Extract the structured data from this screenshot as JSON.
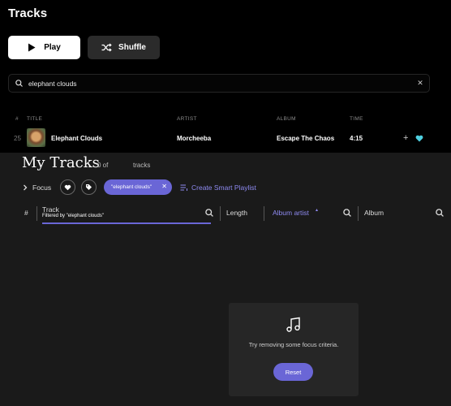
{
  "top": {
    "title": "Tracks",
    "play_label": "Play",
    "shuffle_label": "Shuffle",
    "search_value": "elephant clouds",
    "columns": {
      "num": "#",
      "title": "TITLE",
      "artist": "ARTIST",
      "album": "ALBUM",
      "time": "TIME"
    },
    "row": {
      "num": "25",
      "title": "Elephant Clouds",
      "artist": "Morcheeba",
      "album": "Escape The Chaos",
      "time": "4:15"
    }
  },
  "mytracks": {
    "title": "My Tracks",
    "count": "0 of",
    "count_suffix": "tracks",
    "focus_label": "Focus",
    "filter_chip": "\"elephant clouds\"",
    "create_smart": "Create Smart Playlist",
    "columns": {
      "num": "#",
      "track": "Track",
      "track_filter": "Filtered by \"elephant clouds\"",
      "length": "Length",
      "album_artist": "Album artist",
      "album": "Album"
    },
    "empty_message": "Try removing some focus criteria.",
    "reset_label": "Reset"
  },
  "colors": {
    "accent": "#6a66d6",
    "link": "#8e8af0",
    "heart": "#4fd0e0"
  }
}
